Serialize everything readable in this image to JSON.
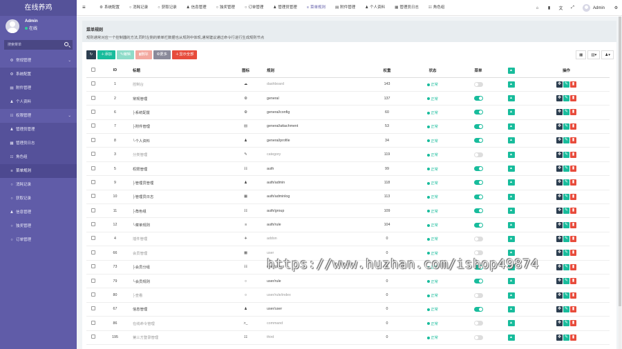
{
  "app": {
    "title": "在线养鸡"
  },
  "user": {
    "name": "Admin",
    "status": "在线"
  },
  "sidebar": {
    "search_placeholder": "搜索菜单",
    "items": [
      {
        "label": "常规管理",
        "icon": "⚙",
        "type": "group"
      },
      {
        "label": "系统配置",
        "icon": "⚙",
        "type": "sub"
      },
      {
        "label": "附件管理",
        "icon": "▤",
        "type": "sub"
      },
      {
        "label": "个人资料",
        "icon": "♟",
        "type": "sub"
      },
      {
        "label": "权限管理",
        "icon": "☷",
        "type": "group-open"
      },
      {
        "label": "管理员管理",
        "icon": "♟",
        "type": "sub"
      },
      {
        "label": "管理员日志",
        "icon": "▦",
        "type": "sub"
      },
      {
        "label": "角色组",
        "icon": "☷",
        "type": "sub"
      },
      {
        "label": "菜单规则",
        "icon": "≡",
        "type": "active"
      },
      {
        "label": "消耗记录",
        "icon": "○",
        "type": "item"
      },
      {
        "label": "获取记录",
        "icon": "○",
        "type": "item"
      },
      {
        "label": "信息管理",
        "icon": "♟",
        "type": "item"
      },
      {
        "label": "独奖管理",
        "icon": "○",
        "type": "item"
      },
      {
        "label": "订单管理",
        "icon": "○",
        "type": "item"
      }
    ]
  },
  "topbar": {
    "tabs": [
      {
        "label": "系统配置",
        "icon": "⚙"
      },
      {
        "label": "消耗记录",
        "icon": "○"
      },
      {
        "label": "获取记录",
        "icon": "○"
      },
      {
        "label": "信息管理",
        "icon": "♟"
      },
      {
        "label": "独奖管理",
        "icon": "○"
      },
      {
        "label": "订单管理",
        "icon": "○"
      },
      {
        "label": "管理员管理",
        "icon": "♟"
      },
      {
        "label": "菜单规则",
        "icon": "≡",
        "active": true
      },
      {
        "label": "附件管理",
        "icon": "▤"
      },
      {
        "label": "个人资料",
        "icon": "♟"
      },
      {
        "label": "管理员日志",
        "icon": "▦"
      },
      {
        "label": "角色组",
        "icon": "☷"
      }
    ],
    "admin": "Admin"
  },
  "panel": {
    "title": "菜单规则",
    "desc": "规则通常对应一个控制器的方法,同时左侧的菜单栏数据也从规则中体现,通常建议通过命令行进行生成规则节点"
  },
  "toolbar": {
    "add": "添加",
    "edit": "编辑",
    "delete": "删除",
    "more": "更多",
    "show_all": "显示全部"
  },
  "table": {
    "headers": {
      "id": "ID",
      "title": "标题",
      "icon": "图标",
      "rule": "规则",
      "weigh": "权重",
      "status": "状态",
      "menu": "菜单",
      "op": "操作"
    },
    "rows": [
      {
        "id": "1",
        "title": "控制台",
        "icon": "☁",
        "rule": "dashboard",
        "weigh": "143",
        "status": "正常",
        "menu": false
      },
      {
        "id": "2",
        "title": "常规管理",
        "icon": "⚙",
        "rule": "general",
        "weigh": "137",
        "status": "正常",
        "menu": true
      },
      {
        "id": "6",
        "title": "├系统配置",
        "icon": "⚙",
        "rule": "general/config",
        "weigh": "60",
        "status": "正常",
        "menu": true
      },
      {
        "id": "7",
        "title": "├附件管理",
        "icon": "▤",
        "rule": "general/attachment",
        "weigh": "53",
        "status": "正常",
        "menu": true
      },
      {
        "id": "8",
        "title": "└个人资料",
        "icon": "♟",
        "rule": "general/profile",
        "weigh": "34",
        "status": "正常",
        "menu": true
      },
      {
        "id": "3",
        "title": "分类管理",
        "icon": "✎",
        "rule": "category",
        "weigh": "119",
        "status": "正常",
        "menu": false
      },
      {
        "id": "5",
        "title": "权限管理",
        "icon": "☷",
        "rule": "auth",
        "weigh": "99",
        "status": "正常",
        "menu": true
      },
      {
        "id": "9",
        "title": "├管理员管理",
        "icon": "♟",
        "rule": "auth/admin",
        "weigh": "118",
        "status": "正常",
        "menu": true
      },
      {
        "id": "10",
        "title": "├管理员日志",
        "icon": "▦",
        "rule": "auth/adminlog",
        "weigh": "113",
        "status": "正常",
        "menu": true
      },
      {
        "id": "11",
        "title": "├角色组",
        "icon": "☷",
        "rule": "auth/group",
        "weigh": "109",
        "status": "正常",
        "menu": true
      },
      {
        "id": "12",
        "title": "└菜单规则",
        "icon": "≡",
        "rule": "auth/rule",
        "weigh": "104",
        "status": "正常",
        "menu": true
      },
      {
        "id": "4",
        "title": "插件管理",
        "icon": "✈",
        "rule": "addon",
        "weigh": "0",
        "status": "正常",
        "menu": false
      },
      {
        "id": "66",
        "title": "会员管理",
        "icon": "▦",
        "rule": "user",
        "weigh": "0",
        "status": "正常",
        "menu": false
      },
      {
        "id": "73",
        "title": "├会员分组",
        "icon": "☷",
        "rule": "user/group",
        "weigh": "0",
        "status": "正常",
        "menu": true
      },
      {
        "id": "79",
        "title": "└会员规则",
        "icon": "○",
        "rule": "user/rule",
        "weigh": "0",
        "status": "正常",
        "menu": true
      },
      {
        "id": "80",
        "title": "├查看",
        "icon": "○",
        "rule": "user/rule/index",
        "weigh": "0",
        "status": "正常",
        "menu": false
      },
      {
        "id": "67",
        "title": "信息管理",
        "icon": "♟",
        "rule": "user/user",
        "weigh": "0",
        "status": "正常",
        "menu": true
      },
      {
        "id": "86",
        "title": "在线命令管理",
        "icon": ">_",
        "rule": "command",
        "weigh": "0",
        "status": "正常",
        "menu": false
      },
      {
        "id": "195",
        "title": "第三方登录管理",
        "icon": "☷",
        "rule": "third",
        "weigh": "0",
        "status": "正常",
        "menu": false
      }
    ]
  },
  "watermark": "https://www.huzhan.com/ishop49874"
}
